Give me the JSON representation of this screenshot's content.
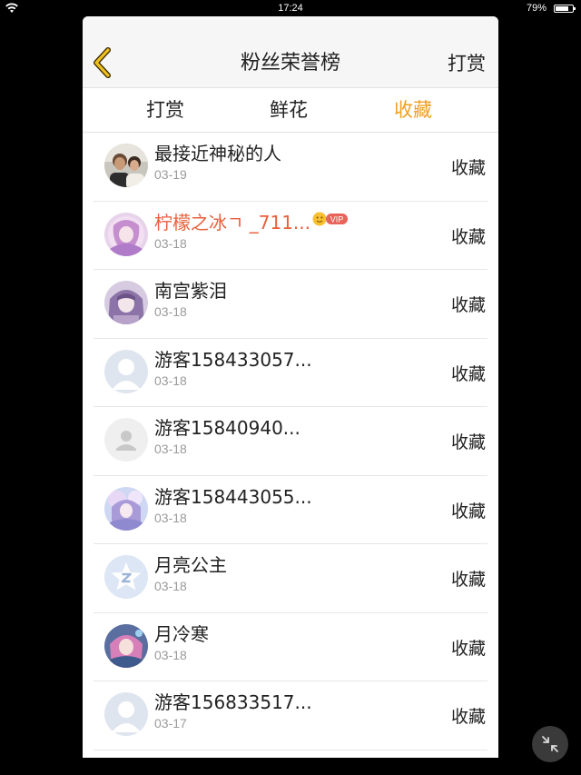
{
  "status_bar": {
    "time": "17:24",
    "battery_percent_text": "79%",
    "battery_level": 0.79
  },
  "header": {
    "title": "粉丝荣誉榜",
    "action_label": "打赏"
  },
  "tabs": [
    {
      "label": "打赏",
      "active": false
    },
    {
      "label": "鲜花",
      "active": false
    },
    {
      "label": "收藏",
      "active": true
    }
  ],
  "fans": [
    {
      "name": "最接近神秘的人",
      "date": "03-19",
      "action": "收藏",
      "vip": false,
      "avatar": "photo-couple-avatar"
    },
    {
      "name": "柠檬之冰ㄱ _711...",
      "date": "03-18",
      "action": "收藏",
      "vip": true,
      "avatar": "anime-pink-avatar"
    },
    {
      "name": "南宫紫泪",
      "date": "03-18",
      "action": "收藏",
      "vip": false,
      "avatar": "anime-purple-avatar"
    },
    {
      "name": "游客158433057...",
      "date": "03-18",
      "action": "收藏",
      "vip": false,
      "avatar": "default-blue-avatar"
    },
    {
      "name": "游客15840940...",
      "date": "03-18",
      "action": "收藏",
      "vip": false,
      "avatar": "default-gray-avatar"
    },
    {
      "name": "游客158443055...",
      "date": "03-18",
      "action": "收藏",
      "vip": false,
      "avatar": "anime-fairy-avatar"
    },
    {
      "name": "月亮公主",
      "date": "03-18",
      "action": "收藏",
      "vip": false,
      "avatar": "qq-star-avatar"
    },
    {
      "name": "月冷寒",
      "date": "03-18",
      "action": "收藏",
      "vip": false,
      "avatar": "anime-warrior-avatar"
    },
    {
      "name": "游客156833517...",
      "date": "03-17",
      "action": "收藏",
      "vip": false,
      "avatar": "default-blue-avatar"
    }
  ],
  "vip_badge_text": "VIP",
  "colors": {
    "accent": "#f0a020",
    "vip_name": "#e8603c",
    "vip_badge": "#e8635a"
  }
}
